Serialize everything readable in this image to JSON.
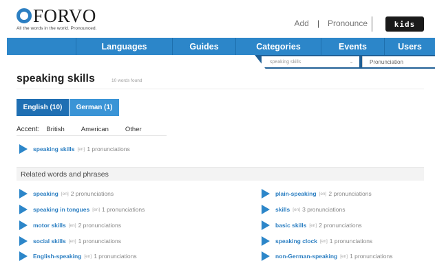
{
  "header": {
    "logo_text": "FORVO",
    "tagline": "All the words in the world. Pronounced.",
    "add_label": "Add",
    "pronounce_label": "Pronounce",
    "kids_label": "kids"
  },
  "nav": {
    "items": [
      {
        "label": "Languages"
      },
      {
        "label": "Guides"
      },
      {
        "label": "Categories"
      },
      {
        "label": "Events"
      },
      {
        "label": "Users"
      }
    ]
  },
  "search": {
    "value": "speaking skills",
    "pronunciation_label": "Pronunciation"
  },
  "page": {
    "title": "speaking skills",
    "count_text": "10 words found"
  },
  "tabs": [
    {
      "label": "English (10)"
    },
    {
      "label": "German (1)"
    }
  ],
  "accent": {
    "label": "Accent:",
    "options": [
      "British",
      "American",
      "Other"
    ]
  },
  "main_entry": {
    "word": "speaking skills",
    "lang": "[en]",
    "prons": "1 pronunciations"
  },
  "related": {
    "heading": "Related words and phrases",
    "left": [
      {
        "word": "speaking",
        "lang": "[en]",
        "prons": "2 pronunciations"
      },
      {
        "word": "speaking in tongues",
        "lang": "[en]",
        "prons": "1 pronunciations"
      },
      {
        "word": "motor skills",
        "lang": "[en]",
        "prons": "2 pronunciations"
      },
      {
        "word": "social skills",
        "lang": "[en]",
        "prons": "1 pronunciations"
      },
      {
        "word": "English-speaking",
        "lang": "[en]",
        "prons": "1 pronunciations"
      }
    ],
    "right": [
      {
        "word": "plain-speaking",
        "lang": "[en]",
        "prons": "2 pronunciations"
      },
      {
        "word": "skills",
        "lang": "[en]",
        "prons": "3 pronunciations"
      },
      {
        "word": "basic skills",
        "lang": "[en]",
        "prons": "2 pronunciations"
      },
      {
        "word": "speaking clock",
        "lang": "[en]",
        "prons": "1 pronunciations"
      },
      {
        "word": "non-German-speaking",
        "lang": "[en]",
        "prons": "1 pronunciations"
      }
    ]
  },
  "colors": {
    "brand_blue": "#2c86c9",
    "link_blue": "#2c7fc2",
    "kids_black": "#1a1a1a"
  }
}
